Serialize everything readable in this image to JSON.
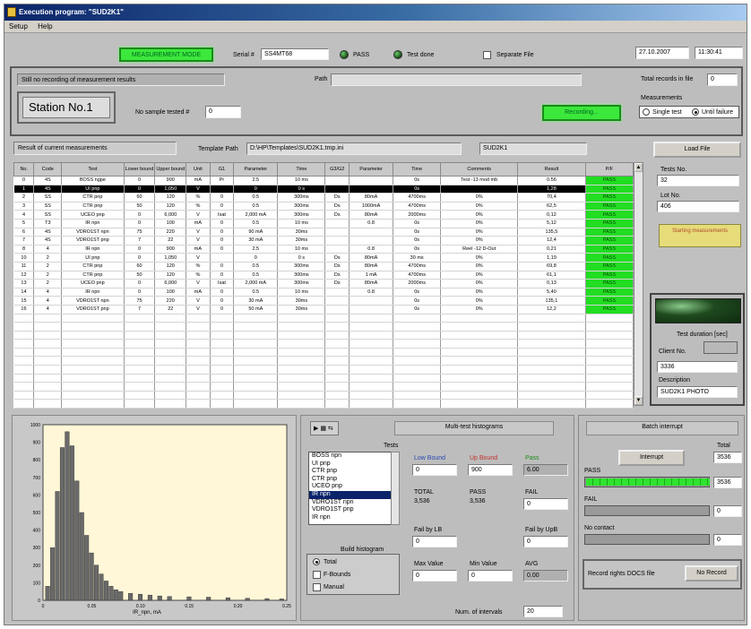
{
  "window": {
    "title": "Execution program: \"SUD2K1\""
  },
  "menu": [
    "Setup",
    "Help"
  ],
  "top": {
    "mode_label": "MEASUREMENT MODE",
    "serial_label": "Serial #",
    "serial_value": "SS4MT68",
    "pass_label": "PASS",
    "test_done_label": "Test done",
    "separate_file_label": "Separate File",
    "date": "27.10.2007",
    "time": "11:30:41"
  },
  "status": {
    "message": "Still no recording of measurement results",
    "path_label": "Path",
    "path_value": "",
    "total_records_label": "Total records in file",
    "total_records_value": "0"
  },
  "station": {
    "name": "Station No.1",
    "sample_label": "No sample tested #",
    "sample_value": "0",
    "recording_button": "Recording...",
    "measurements_label": "Measurements",
    "single_test": "Single test",
    "until_failure": "Until failure"
  },
  "results": {
    "header": "Result of current measurements",
    "template_label": "Template Path",
    "template_path": "D:\\HP\\Templates\\SUD2K1.tmp.ini",
    "template_name": "SUD2K1"
  },
  "table": {
    "columns": [
      "No.",
      "Code",
      "Test",
      "Lower bound",
      "Upper bound",
      "Unit",
      "G1",
      "Parameter",
      "Time",
      "G3/G2",
      "Parameter",
      "Time",
      "Comments",
      "Result",
      "P/F"
    ],
    "rows": [
      [
        "0",
        "4S",
        "BOSS ngpe",
        "0",
        "900",
        "mA",
        "Pr",
        "2.5",
        "10 ms",
        "",
        "",
        "0s",
        "Test -13 mod mb",
        "0.56",
        "PASS"
      ],
      [
        "1",
        "4S",
        "UI pnp",
        "0",
        "1,050",
        "V",
        "",
        "0",
        "0 s",
        "",
        "",
        "0s",
        "",
        "1,28",
        "PASS"
      ],
      [
        "2",
        "SS",
        "CTR pnp",
        "60",
        "120",
        "%",
        "0",
        "0.5",
        "300ms",
        "Ds",
        "80mA",
        "4700ms",
        "0%",
        "70,4",
        "PASS"
      ],
      [
        "3",
        "SS",
        "CTR pnp",
        "50",
        "120",
        "%",
        "0",
        "0.5",
        "300ms",
        "Ds",
        "1000mA",
        "4700ms",
        "0%",
        "62,5",
        "PASS"
      ],
      [
        "4",
        "SS",
        "UCEO pnp",
        "0",
        "6,000",
        "V",
        "Isat",
        "2,000 mA",
        "300ms",
        "Ds",
        "80mA",
        "2000ms",
        "0%",
        "0,12",
        "PASS"
      ],
      [
        "5",
        "T3",
        "IR npn",
        "0",
        "100",
        "mA",
        "0",
        "0.5",
        "10 ms",
        "",
        "0.8",
        "0s",
        "0%",
        "5,12",
        "PASS"
      ],
      [
        "6",
        "4S",
        "VDRO1ST npn",
        "75",
        "220",
        "V",
        "0",
        "90 mA",
        "30ms",
        "",
        "",
        "0s",
        "0%",
        "135,5",
        "PASS"
      ],
      [
        "7",
        "4S",
        "VDRO1ST pnp",
        "7",
        "22",
        "V",
        "0",
        "30 mA",
        "30ms",
        "",
        "",
        "0s",
        "0%",
        "12,4",
        "PASS"
      ],
      [
        "8",
        "4",
        "IR npn",
        "0",
        "900",
        "mA",
        "0",
        "2.5",
        "10 ms",
        "",
        "0.8",
        "0s",
        "Reel -12 D-Out",
        "0,21",
        "PASS"
      ],
      [
        "10",
        "2",
        "UI pnp",
        "0",
        "1,050",
        "V",
        "",
        "0",
        "0 s",
        "Ds",
        "80mA",
        "30 ms",
        "0%",
        "1,19",
        "PASS"
      ],
      [
        "11",
        "2",
        "CTR pnp",
        "60",
        "120",
        "%",
        "0",
        "0.5",
        "300ms",
        "Ds",
        "80mA",
        "4700ms",
        "0%",
        "69,8",
        "PASS"
      ],
      [
        "12",
        "2",
        "CTR pnp",
        "50",
        "120",
        "%",
        "0",
        "0.5",
        "300ms",
        "Ds",
        "1 mA",
        "4700ms",
        "0%",
        "61,1",
        "PASS"
      ],
      [
        "13",
        "2",
        "UCEO pnp",
        "0",
        "6,000",
        "V",
        "Isat",
        "2,000 mA",
        "300ms",
        "Ds",
        "80mA",
        "2000ms",
        "0%",
        "0,13",
        "PASS"
      ],
      [
        "14",
        "4",
        "IR npn",
        "0",
        "100",
        "mA",
        "0",
        "0.5",
        "10 ms",
        "",
        "0.8",
        "0s",
        "0%",
        "5,40",
        "PASS"
      ],
      [
        "15",
        "4",
        "VDRO1ST npn",
        "75",
        "220",
        "V",
        "0",
        "30 mA",
        "30ms",
        "",
        "",
        "0s",
        "0%",
        "135,1",
        "PASS"
      ],
      [
        "16",
        "4",
        "VDRO1ST pnp",
        "7",
        "22",
        "V",
        "0",
        "50 mA",
        "30ms",
        "",
        "",
        "0s",
        "0%",
        "12,2",
        "PASS"
      ]
    ]
  },
  "right_panel": {
    "load_button": "Load File",
    "tests_label": "Tests No.",
    "tests_value": "32",
    "lot_label": "Lot No.",
    "lot_value": "406",
    "warning": "Starting measurements",
    "test_duration_label": "Test duration [sec]",
    "client_label": "Client No.",
    "client_value": "3336",
    "description_label": "Description",
    "description_value": "SUD2K1 PHOTO"
  },
  "histogram": {
    "xlabel": "IR_npn, mA",
    "xticks": [
      "0",
      "0.05",
      "0.10",
      "0.15",
      "0.20",
      "0.25"
    ],
    "yticks": [
      "1000",
      "900",
      "800",
      "700",
      "600",
      "500",
      "400",
      "300",
      "200",
      "100",
      "0"
    ]
  },
  "chart_data": {
    "type": "bar",
    "x": [
      0.005,
      0.01,
      0.015,
      0.02,
      0.025,
      0.03,
      0.035,
      0.04,
      0.045,
      0.05,
      0.055,
      0.06,
      0.065,
      0.07,
      0.075,
      0.08,
      0.09,
      0.1,
      0.11,
      0.12,
      0.13,
      0.15,
      0.17,
      0.19,
      0.21,
      0.23,
      0.245
    ],
    "values": [
      80,
      300,
      620,
      870,
      960,
      880,
      680,
      500,
      370,
      270,
      200,
      150,
      110,
      80,
      60,
      50,
      40,
      35,
      30,
      25,
      22,
      20,
      18,
      15,
      12,
      10,
      8
    ],
    "xlabel": "IR_npn, mA",
    "ylim": [
      0,
      1000
    ],
    "xlim": [
      0,
      0.25
    ]
  },
  "stats": {
    "tabs_header": "Multi-test histograms",
    "tests_label": "Tests",
    "test_list": [
      "BOSS npn",
      "UI pnp",
      "CTR pnp",
      "CTR pnp",
      "UCEO pnp",
      "IR npn",
      "VDRO1ST npn",
      "VDRO1ST pnp",
      "IR npn"
    ],
    "selected_index": 5,
    "build_label": "Build histogram",
    "radio_total": "Total",
    "radio_fbounds": "F-Bounds",
    "radio_manual": "Manual",
    "low_bound_label": "Low Bound",
    "low_bound": "0",
    "up_bound_label": "Up Bound",
    "up_bound": "900",
    "pass_label": "Pass",
    "pass_value": "6.00",
    "total_label": "TOTAL",
    "total_value": "3,536",
    "pass_caps_label": "PASS",
    "pass_caps_value": "3,536",
    "fail_label": "FAIL",
    "fail_value": "0",
    "fail_lo_label": "Fail by LB",
    "fail_lo": "0",
    "fail_up_label": "Fail by UpB",
    "fail_up": "0",
    "max_label": "Max Value",
    "max_value": "0",
    "min_label": "Min Value",
    "min_value": "0",
    "avg_label": "AVG",
    "avg_value": "0.00",
    "intervals_label": "Num. of intervals",
    "intervals_value": "20"
  },
  "batch": {
    "header": "Batch interrupt",
    "total_label": "Total",
    "total_value": "3536",
    "pass_label": "PASS",
    "pass_value": "3536",
    "fail_label": "FAIL",
    "fail_value": "0",
    "no_contact_label": "No contact",
    "no_contact_value": "0",
    "interrupt_button": "Interrupt",
    "record_label": "Record rights DOCS file",
    "record_button": "No Record",
    "pass_fraction": 1.0
  }
}
